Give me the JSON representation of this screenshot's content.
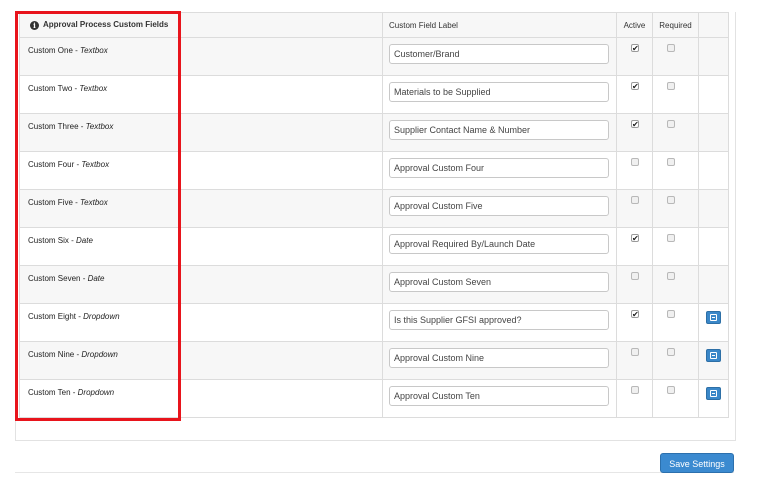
{
  "table": {
    "headers": {
      "field": "Approval Process Custom Fields",
      "label": "Custom Field Label",
      "active": "Active",
      "required": "Required"
    },
    "rows": [
      {
        "name": "Custom One",
        "sep": " - ",
        "type": "Textbox",
        "label": "Customer/Brand",
        "active": true,
        "required": false,
        "has_edit": false
      },
      {
        "name": "Custom Two",
        "sep": " - ",
        "type": "Textbox",
        "label": "Materials to be Supplied",
        "active": true,
        "required": false,
        "has_edit": false
      },
      {
        "name": "Custom Three",
        "sep": " - ",
        "type": "Textbox",
        "label": "Supplier Contact Name & Number",
        "active": true,
        "required": false,
        "has_edit": false
      },
      {
        "name": "Custom Four",
        "sep": " - ",
        "type": "Textbox",
        "label": "Approval Custom Four",
        "active": false,
        "required": false,
        "has_edit": false
      },
      {
        "name": "Custom Five",
        "sep": " - ",
        "type": "Textbox",
        "label": "Approval Custom Five",
        "active": false,
        "required": false,
        "has_edit": false
      },
      {
        "name": "Custom Six",
        "sep": " - ",
        "type": "Date",
        "label": "Approval Required By/Launch Date",
        "active": true,
        "required": false,
        "has_edit": false
      },
      {
        "name": "Custom Seven",
        "sep": " - ",
        "type": "Date",
        "label": "Approval Custom Seven",
        "active": false,
        "required": false,
        "has_edit": false
      },
      {
        "name": "Custom Eight",
        "sep": " - ",
        "type": "Dropdown",
        "label": "Is this Supplier GFSI approved?",
        "active": true,
        "required": false,
        "has_edit": true
      },
      {
        "name": "Custom Nine",
        "sep": " - ",
        "type": "Dropdown",
        "label": "Approval Custom Nine",
        "active": false,
        "required": false,
        "has_edit": true
      },
      {
        "name": "Custom Ten",
        "sep": " - ",
        "type": "Dropdown",
        "label": "Approval Custom Ten",
        "active": false,
        "required": false,
        "has_edit": true
      }
    ]
  },
  "footer": {
    "save_label": "Save Settings"
  },
  "icons": {
    "info": "info-icon",
    "edit": "edit-list-icon",
    "check": "checkmark"
  },
  "colors": {
    "highlight": "#e8141c",
    "button": "#3b8ad0",
    "edit_button": "#3a87c8"
  }
}
